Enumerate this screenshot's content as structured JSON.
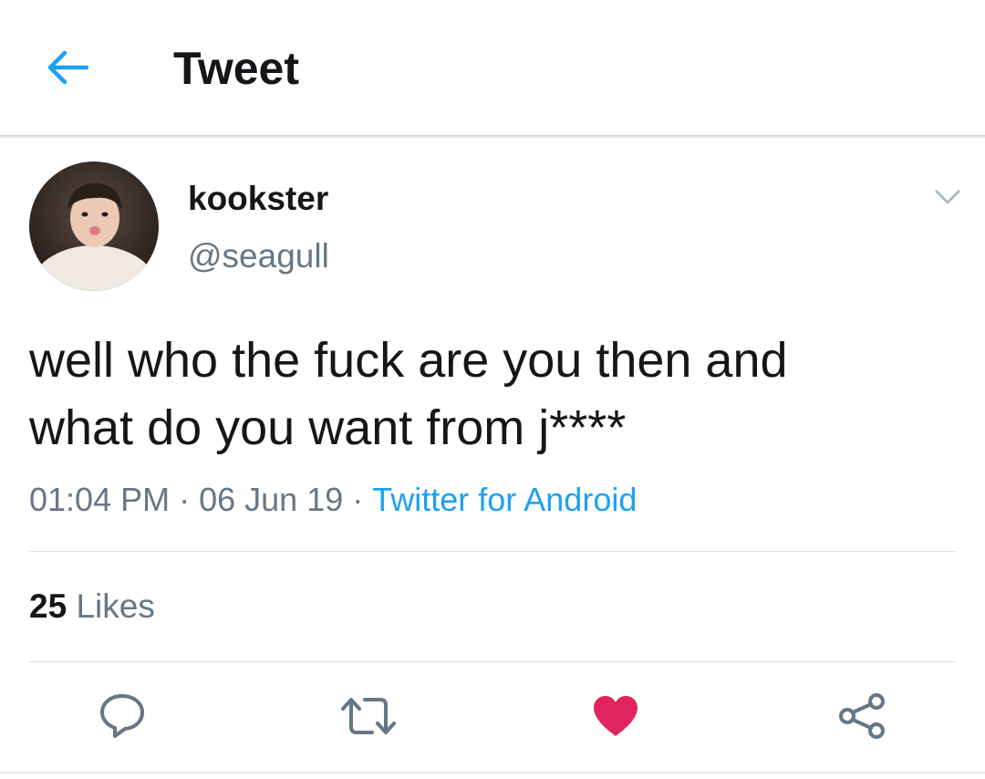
{
  "header": {
    "title": "Tweet",
    "back_icon": "back-arrow-icon",
    "accent_color": "#1da1f2"
  },
  "tweet": {
    "author": {
      "display_name": "kookster",
      "handle": "@seagull"
    },
    "text_line1": "well who the fuck are you then and",
    "text_line2": "what do you want from j****",
    "time": "01:04 PM",
    "separator": "·",
    "date": "06 Jun 19",
    "source": "Twitter for Android",
    "likes_count": "25",
    "likes_label": "Likes"
  },
  "actions": [
    {
      "icon": "reply-icon",
      "color": "#657786"
    },
    {
      "icon": "retweet-icon",
      "color": "#657786"
    },
    {
      "icon": "heart-icon",
      "color": "#e0245e",
      "active": true
    },
    {
      "icon": "share-icon",
      "color": "#657786"
    }
  ],
  "colors": {
    "text": "#14171a",
    "secondary": "#657786",
    "link": "#1da1f2",
    "like": "#e0245e"
  }
}
